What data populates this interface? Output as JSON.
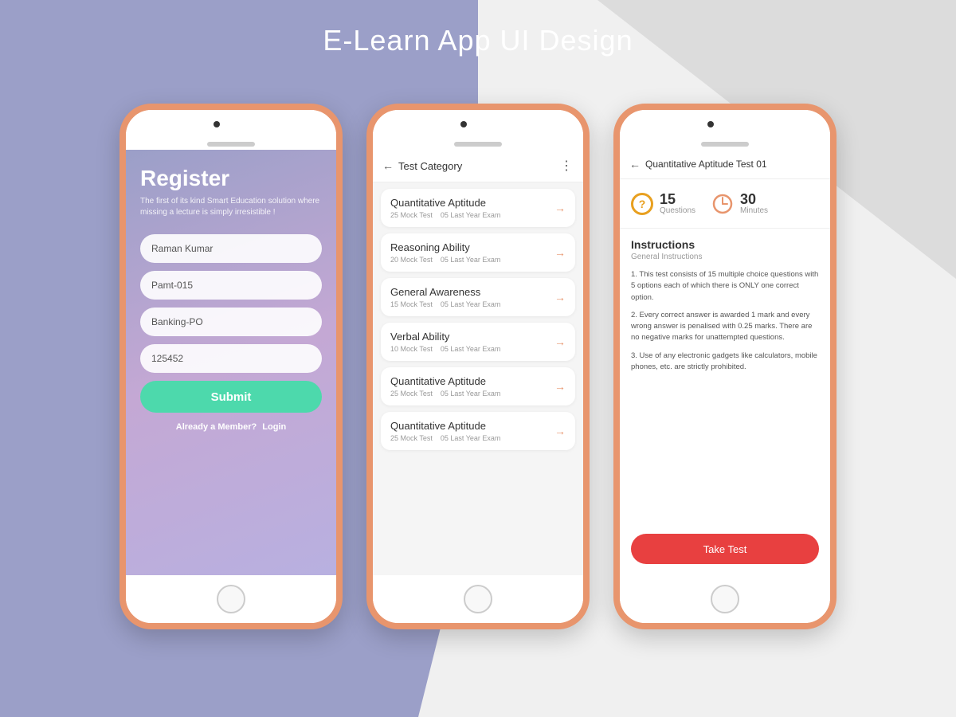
{
  "page": {
    "title": "E-Learn App UI Design",
    "background_color_left": "#9b9fc8",
    "background_color_right": "#f0f0f0"
  },
  "phone1": {
    "screen": "register",
    "register": {
      "title": "Register",
      "subtitle": "The first of its kind Smart Education solution where missing a lecture is simply irresistible !",
      "fields": [
        {
          "value": "Raman Kumar"
        },
        {
          "value": "Pamt-015"
        },
        {
          "value": "Banking-PO"
        },
        {
          "value": "125452"
        }
      ],
      "submit_label": "Submit",
      "member_text": "Already a Member?",
      "login_label": "Login"
    }
  },
  "phone2": {
    "screen": "test_category",
    "header": {
      "back_label": "←",
      "title": "Test Category",
      "menu_icon": "⋮"
    },
    "test_items": [
      {
        "name": "Quantitative Aptitude",
        "mock": "25 Mock Test",
        "exam": "05 Last Year Exam"
      },
      {
        "name": "Reasoning Ability",
        "mock": "20 Mock Test",
        "exam": "05 Last Year Exam"
      },
      {
        "name": "General Awareness",
        "mock": "15 Mock Test",
        "exam": "05 Last Year Exam"
      },
      {
        "name": "Verbal Ability",
        "mock": "10 Mock Test",
        "exam": "05 Last Year Exam"
      },
      {
        "name": "Quantitative Aptitude",
        "mock": "25 Mock Test",
        "exam": "05 Last Year Exam"
      },
      {
        "name": "Quantitative Aptitude",
        "mock": "25 Mock Test",
        "exam": "05 Last Year Exam"
      }
    ],
    "arrow": "→"
  },
  "phone3": {
    "screen": "test_detail",
    "header": {
      "back_label": "←",
      "title": "Quantitative Aptitude Test 01"
    },
    "stats": {
      "questions": {
        "number": "15",
        "label": "Questions"
      },
      "minutes": {
        "number": "30",
        "label": "Minutes"
      }
    },
    "instructions": {
      "title": "Instructions",
      "subtitle": "General Instructions",
      "items": [
        "1. This test consists of 15 multiple choice questions with 5 options each of which there is ONLY one correct option.",
        "2. Every correct answer is awarded 1 mark and every wrong answer is penalised with 0.25 marks. There are no negative marks for unattempted questions.",
        "3. Use of any electronic gadgets like calculators, mobile phones, etc. are strictly prohibited."
      ]
    },
    "take_test_label": "Take Test"
  }
}
